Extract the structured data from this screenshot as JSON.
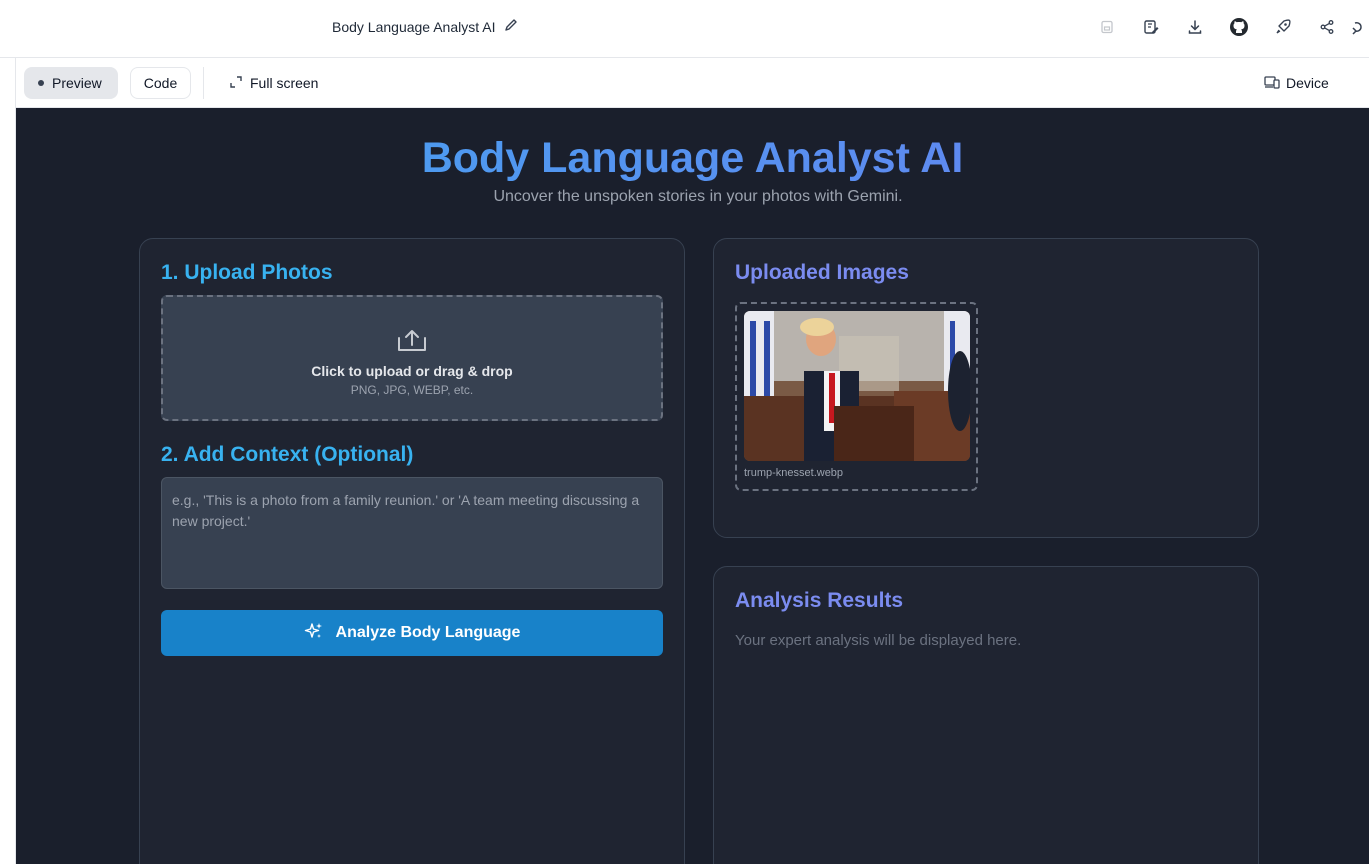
{
  "topbar": {
    "app_title": "Body Language Analyst AI",
    "icons": [
      "edit-icon",
      "save-icon",
      "save-as-icon",
      "download-icon",
      "github-icon",
      "rocket-icon",
      "share-icon",
      "more-icon"
    ]
  },
  "toolbar": {
    "preview_label": "Preview",
    "code_label": "Code",
    "fullscreen_label": "Full screen",
    "device_label": "Device"
  },
  "hero": {
    "title": "Body Language Analyst AI",
    "subtitle": "Uncover the unspoken stories in your photos with Gemini."
  },
  "upload": {
    "heading": "1. Upload Photos",
    "main_text": "Click to upload or drag & drop",
    "sub_text": "PNG, JPG, WEBP, etc."
  },
  "context": {
    "heading": "2. Add Context (Optional)",
    "placeholder": "e.g., 'This is a photo from a family reunion.' or 'A team meeting discussing a new project.'",
    "value": ""
  },
  "analyze_button": {
    "label": "Analyze Body Language"
  },
  "uploaded": {
    "heading": "Uploaded Images",
    "images": [
      {
        "filename": "trump-knesset.webp"
      }
    ]
  },
  "results": {
    "heading": "Analysis Results",
    "placeholder": "Your expert analysis will be displayed here."
  },
  "colors": {
    "stage_bg": "#1a1f2c",
    "card_bg": "#1f2431",
    "accent_blue": "#38b2f0",
    "accent_purple": "#7b8cf0",
    "button_blue": "#1882c9"
  }
}
